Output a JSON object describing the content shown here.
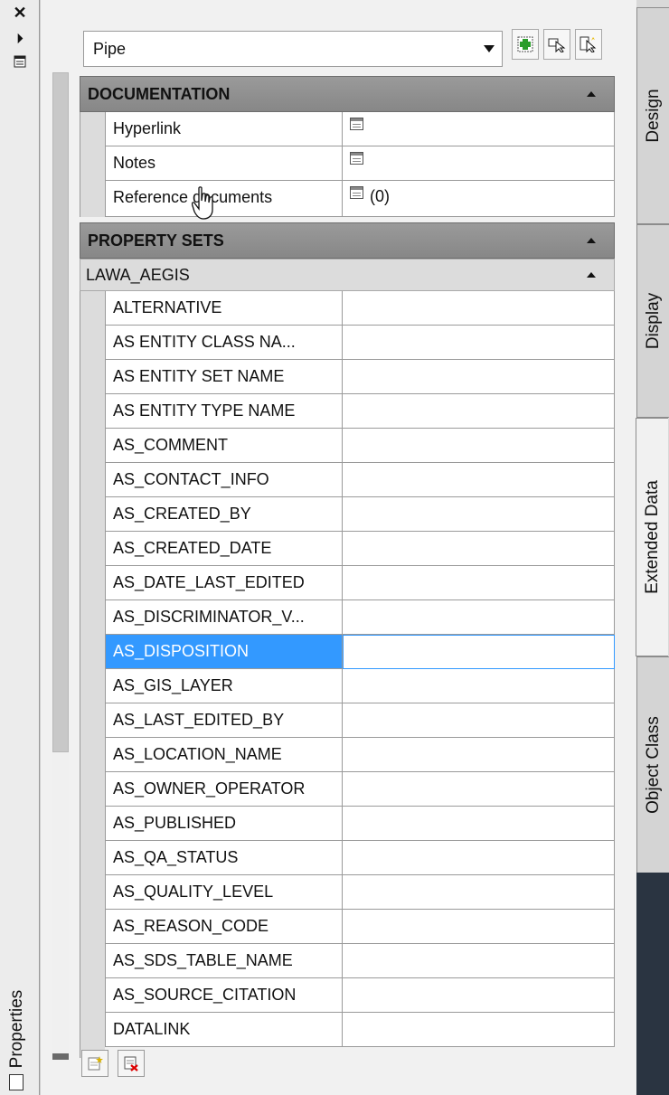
{
  "window": {
    "title": "Properties"
  },
  "toolbar": {
    "object_type": "Pipe"
  },
  "documentation": {
    "header": "DOCUMENTATION",
    "rows": [
      {
        "label": "Hyperlink",
        "value": ""
      },
      {
        "label": "Notes",
        "value": ""
      },
      {
        "label": "Reference documents",
        "value": "(0)"
      }
    ]
  },
  "property_sets": {
    "header": "PROPERTY SETS",
    "set_name": "LAWA_AEGIS",
    "rows": [
      "ALTERNATIVE",
      "AS ENTITY CLASS NA...",
      "AS ENTITY SET NAME",
      "AS ENTITY TYPE NAME",
      "AS_COMMENT",
      "AS_CONTACT_INFO",
      "AS_CREATED_BY",
      "AS_CREATED_DATE",
      "AS_DATE_LAST_EDITED",
      "AS_DISCRIMINATOR_V...",
      "AS_DISPOSITION",
      "AS_GIS_LAYER",
      "AS_LAST_EDITED_BY",
      "AS_LOCATION_NAME",
      "AS_OWNER_OPERATOR",
      "AS_PUBLISHED",
      "AS_QA_STATUS",
      "AS_QUALITY_LEVEL",
      "AS_REASON_CODE",
      "AS_SDS_TABLE_NAME",
      "AS_SOURCE_CITATION",
      "DATALINK"
    ],
    "selected": "AS_DISPOSITION"
  },
  "tabs": [
    "Design",
    "Display",
    "Extended Data",
    "Object Class"
  ],
  "active_tab": "Extended Data",
  "colors": {
    "selection": "#3399ff",
    "category_header": "#8f8f8f",
    "dark_area": "#2a3441"
  },
  "icons": [
    "close-icon",
    "autohide-icon",
    "properties-menu-icon",
    "quick-select-icon",
    "select-objects-icon",
    "toggle-pickadd-icon",
    "add-property-set-icon",
    "remove-property-set-icon"
  ]
}
